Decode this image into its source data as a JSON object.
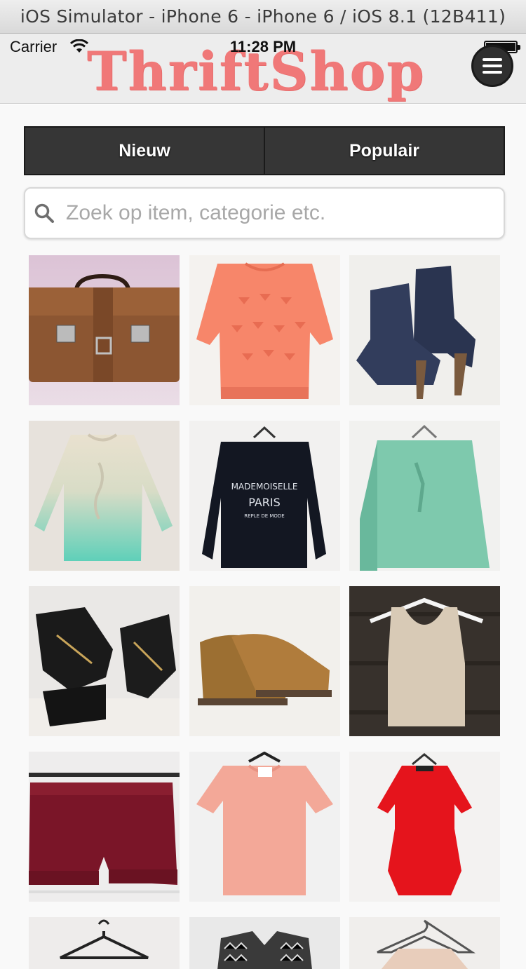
{
  "window": {
    "title": "iOS Simulator - iPhone 6 - iPhone 6 / iOS 8.1 (12B411)"
  },
  "status_bar": {
    "carrier": "Carrier",
    "time": "11:28 PM"
  },
  "header": {
    "logo_text": "ThriftShop",
    "menu_icon": "hamburger-icon"
  },
  "tabs": [
    {
      "label": "Nieuw"
    },
    {
      "label": "Populair"
    }
  ],
  "search": {
    "placeholder": "Zoek op item, categorie etc.",
    "value": "",
    "icon": "search-icon"
  },
  "products": [
    {
      "name": "briefcase"
    },
    {
      "name": "coral-sweater"
    },
    {
      "name": "navy-ankle-boots"
    },
    {
      "name": "ombre-knit-sweater"
    },
    {
      "name": "mademoiselle-sweatshirt",
      "print_text": [
        "MADEMOISELLE",
        "PARIS",
        "REPLE DE MODE"
      ]
    },
    {
      "name": "mint-blouse"
    },
    {
      "name": "black-wedge-sandals"
    },
    {
      "name": "suede-desert-boots"
    },
    {
      "name": "beige-tank-top"
    },
    {
      "name": "burgundy-shorts"
    },
    {
      "name": "pink-lace-top"
    },
    {
      "name": "red-dress"
    },
    {
      "name": "hanger-top"
    },
    {
      "name": "patterned-jacket"
    },
    {
      "name": "peach-knit-top"
    }
  ],
  "colors": {
    "logo": "#f07878",
    "tab_bg": "#363636",
    "header_bg": "#ededed"
  }
}
